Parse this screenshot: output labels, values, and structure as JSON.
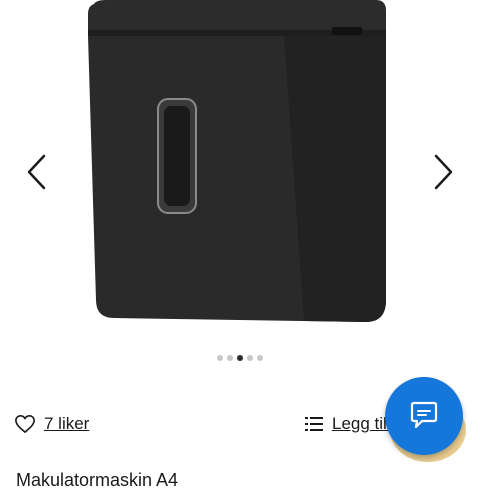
{
  "gallery": {
    "prev_icon": "chevron-left-icon",
    "next_icon": "chevron-right-icon",
    "image_subject": "black paper shredder",
    "slide_count": 5,
    "active_slide": 3
  },
  "actions": {
    "like_icon": "heart-outline-icon",
    "like_label": "7 liker",
    "list_icon": "list-icon",
    "list_label": "Legg til i liste"
  },
  "chat": {
    "icon": "chat-bubble-icon",
    "color": "#1477d9"
  },
  "product": {
    "title": "Makulatormaskin A4"
  },
  "colors": {
    "accent": "#1477d9",
    "dot_active": "#2b2b2b",
    "dot_inactive": "#c7c7c7"
  }
}
